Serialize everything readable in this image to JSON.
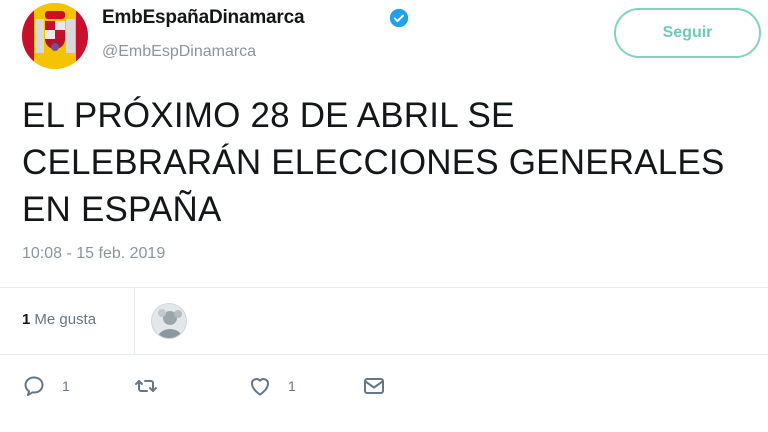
{
  "author": {
    "display_name": "EmbEspañaDinamarca",
    "handle": "@EmbEspDinamarca",
    "verified_icon": "verified-badge-icon",
    "avatar_icon": "coat-of-arms-spain"
  },
  "follow_button": {
    "label": "Seguir"
  },
  "tweet": {
    "lines": [
      "EL PRÓXIMO 28 DE ABRIL SE",
      "CELEBRARÁN ELECCIONES GENERALES",
      "EN ESPAÑA"
    ],
    "timestamp": "10:08 - 15 feb. 2019"
  },
  "stats": {
    "likes_count": "1",
    "likes_label": "Me gusta"
  },
  "actions": {
    "reply_count": "1",
    "retweet_count": "",
    "like_count": "1"
  },
  "colors": {
    "accent": "#6ccdb3",
    "verified": "#1da1f2",
    "muted": "#8a959e"
  }
}
